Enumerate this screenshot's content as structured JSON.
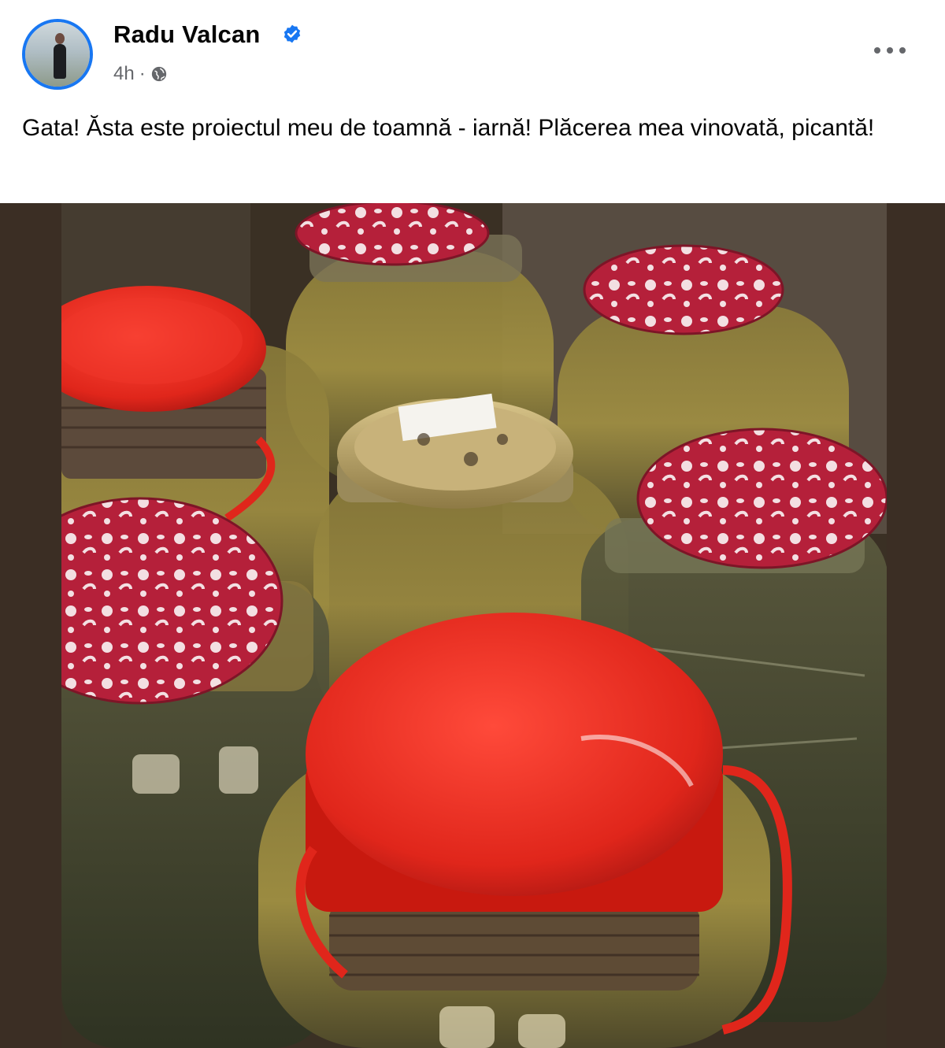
{
  "post": {
    "author": "Radu Valcan",
    "verified_icon": "verified-badge-icon",
    "time": "4h",
    "separator": "·",
    "audience_icon": "globe-icon",
    "menu_icon": "more-options-icon",
    "text": "Gata! Ăsta este proiectul meu de toamnă - iarnă! Plăcerea mea vinovată, picantă!"
  },
  "photo": {
    "subject": "jars-of-pickles",
    "colors": {
      "frame": "#3b2e24",
      "red_lid": "#e0261b",
      "patterned_lid": "#b5203a",
      "brine": "#9c8a3c"
    }
  },
  "colors": {
    "accent": "#1877f2",
    "meta": "#65676b",
    "text": "#050505"
  }
}
